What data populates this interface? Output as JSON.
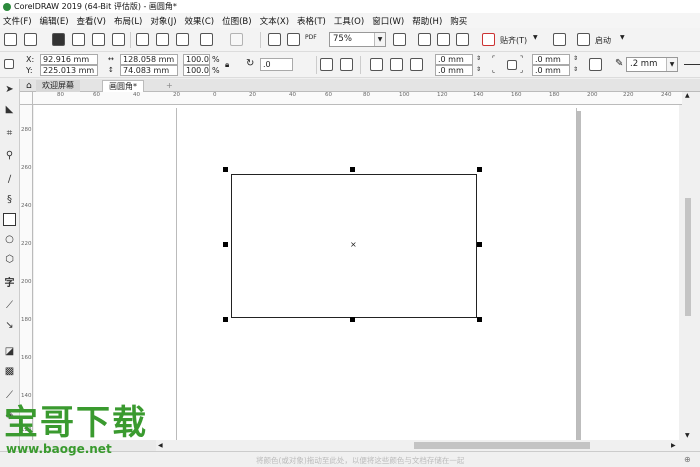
{
  "window": {
    "title": "CorelDRAW 2019 (64-Bit 评估版) - 画圆角*"
  },
  "menu": [
    "文件(F)",
    "编辑(E)",
    "查看(V)",
    "布局(L)",
    "对象(J)",
    "效果(C)",
    "位图(B)",
    "文本(X)",
    "表格(T)",
    "工具(O)",
    "窗口(W)",
    "帮助(H)",
    "购买"
  ],
  "toolbar": {
    "zoom": "75%",
    "snap": "贴齐(T)",
    "launch": "启动",
    "pdf": "PDF"
  },
  "propbar": {
    "x_label": "X:",
    "x_value": "92.916 mm",
    "y_label": "Y:",
    "y_value": "225.013 mm",
    "w_value": "128.058 mm",
    "h_value": "74.083 mm",
    "sx_value": "100.0",
    "sy_value": "100.0",
    "pct": "%",
    "rotate_value": ".0",
    "corner1": ".0 mm",
    "corner2": ".0 mm",
    "corner3": ".0 mm",
    "corner4": ".0 mm",
    "outline_width": ".2 mm"
  },
  "tabs": {
    "welcome": "欢迎屏幕",
    "doc": "画圆角*",
    "add": "+"
  },
  "ruler": {
    "h": [
      "80",
      "60",
      "40",
      "20",
      "0",
      "20",
      "40",
      "60",
      "80",
      "100",
      "120",
      "140",
      "160",
      "180",
      "200",
      "220",
      "240"
    ],
    "v": [
      "280",
      "260",
      "240",
      "220",
      "200",
      "180",
      "160",
      "140",
      "120"
    ]
  },
  "canvas": {
    "center_mark": "×"
  },
  "status": {
    "hint": "将颜色(或对象)拖动至此处，以便将这些颜色与文档存储在一起"
  },
  "watermark": {
    "title": "宝哥下载",
    "url": "www.baoge.net"
  },
  "colors": {
    "accent_green": "#3a9a2f"
  }
}
